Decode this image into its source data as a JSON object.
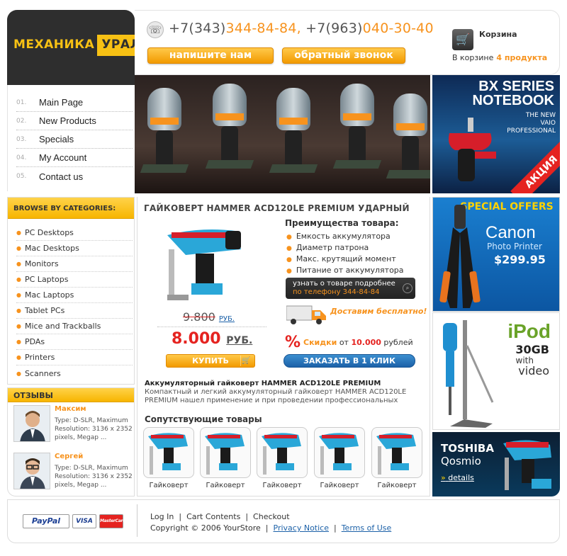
{
  "logo": {
    "part1": "МЕХАНИКА",
    "part2": "УРАЛА"
  },
  "header": {
    "phone1_code": "+7(343)",
    "phone1_number": "344-84-84,",
    "phone2_code": "+7(963)",
    "phone2_number": "040-30-40",
    "write_button": "напишите нам",
    "callback_button": "обратный звонок"
  },
  "cart": {
    "title": "Корзина",
    "label": "В корзине",
    "count": "4 продукта"
  },
  "nav": {
    "items": [
      {
        "num": "01.",
        "label": "Main Page"
      },
      {
        "num": "02.",
        "label": "New Products"
      },
      {
        "num": "03.",
        "label": "Specials"
      },
      {
        "num": "04.",
        "label": "My Account"
      },
      {
        "num": "05.",
        "label": "Contact us"
      }
    ]
  },
  "categories": {
    "title": "BROWSE BY CATEGORIES:",
    "items": [
      "PC Desktops",
      "Mac Desktops",
      "Monitors",
      "PC Laptops",
      "Mac Laptops",
      "Tablet PCs",
      "Mice and Trackballs",
      "PDAs",
      "Printers",
      "Scanners"
    ]
  },
  "reviews": {
    "title": "ОТЗЫВЫ",
    "items": [
      {
        "name": "Максим",
        "text": "Type: D-SLR, Maximum Resolution: 3136 x 2352 pixels, Megap ..."
      },
      {
        "name": "Сергей",
        "text": "Type: D-SLR, Maximum Resolution: 3136 x 2352 pixels, Megap ..."
      }
    ]
  },
  "ads": {
    "bx": {
      "line1": "BX SERIES",
      "line2": "NOTEBOOK",
      "sub1": "THE NEW",
      "sub2": "VAIO",
      "sub3": "PROFESSIONAL",
      "ribbon": "АКЦИЯ"
    },
    "special": {
      "head": "SPECIAL OFFERS",
      "brand": "Canon",
      "product": "Photo Printer",
      "price": "$299.95"
    },
    "ipod": {
      "title": "iPod",
      "size": "30GB",
      "with": "with",
      "video": "video"
    },
    "toshiba": {
      "brand": "TOSHIBA",
      "model": "Qosmio",
      "link": "details"
    }
  },
  "product": {
    "title": "ГАЙКОВЕРТ HAMMER ACD120LE PREMIUM УДАРНЫЙ",
    "old_price": "9.800",
    "old_unit": "РУБ.",
    "new_price": "8.000",
    "new_unit": "РУБ.",
    "buy_label": "КУПИТЬ",
    "advantages_title": "Преимущества товара:",
    "advantages": [
      "Емкость аккумулятора",
      "Диаметр патрона",
      "Макс. крутящий момент",
      "Питание от аккумулятора"
    ],
    "learn_line1": "узнать о товаре подробнее",
    "learn_line2": "по телефону",
    "learn_phone": "344-84-84",
    "delivery": "Доставим бесплатно!",
    "pct": "%",
    "discount_prefix": "Скидки",
    "discount_mid": "от",
    "discount_amount": "10.000",
    "discount_suffix": "рублей",
    "order_label": "ЗАКАЗАТЬ В 1 КЛИК",
    "desc_title": "Аккумуляторный гайковерт HAMMER ACD120LE PREMIUM",
    "desc_text": "Компактный и легкий аккумуляторный гайковерт HAMMER ACD120LE PREMIUM нашел применение и при проведении профессиональных",
    "related_title": "Сопутствующие товары",
    "related": [
      "Гайковерт",
      "Гайковерт",
      "Гайковерт",
      "Гайковерт",
      "Гайковерт"
    ]
  },
  "footer": {
    "paypal": "PayPal",
    "visa": "VISA",
    "mastercard": "MasterCard",
    "links": [
      "Log In",
      "Cart Contents",
      "Checkout"
    ],
    "separator": "|",
    "copyright": "Copyright © 2006 YourStore",
    "privacy": "Privacy Notice",
    "terms": "Terms of Use"
  }
}
